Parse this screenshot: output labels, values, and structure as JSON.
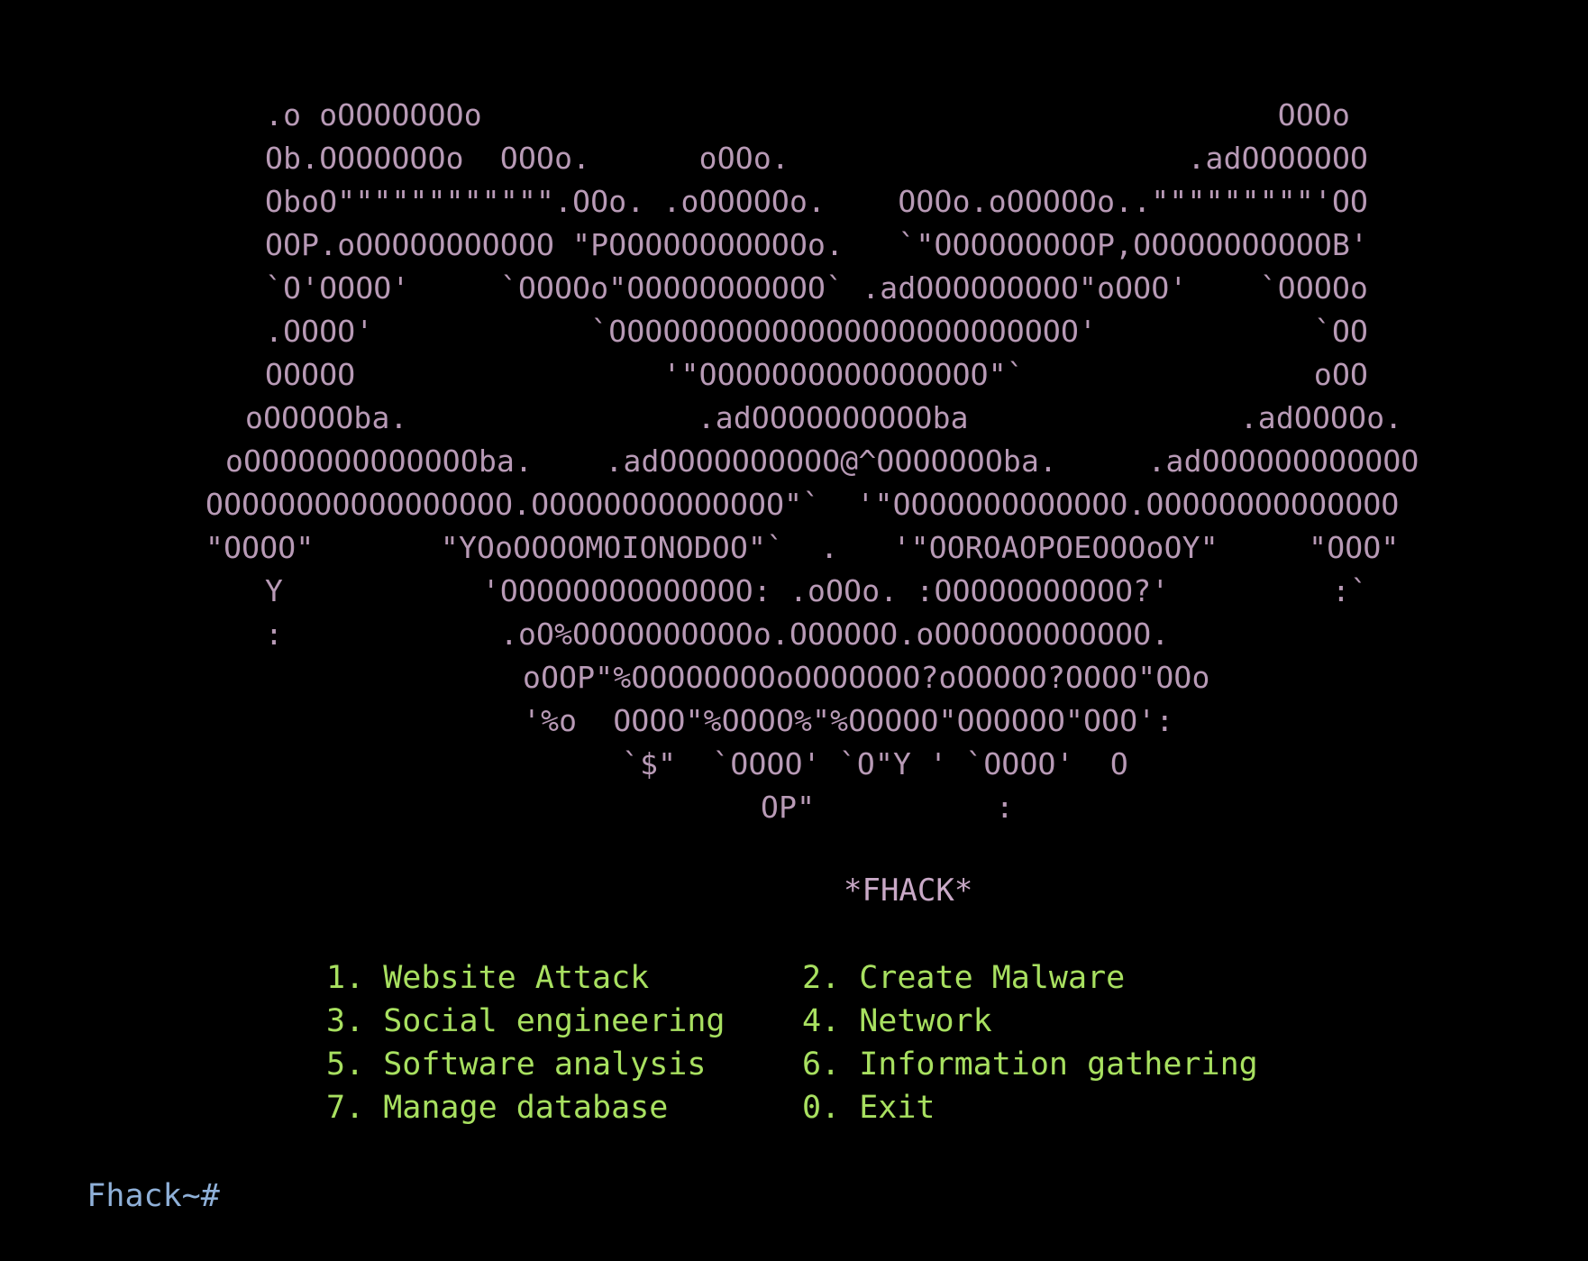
{
  "banner": {
    "lines": [
      ".o oOOOOOOOo                                            OOOo",
      "Ob.OOOOOOOo  OOOo.      oOOo.                      .adOOOOOOO",
      "OboO\"\"\"\"\"\"\"\"\"\"\"\".OOo. .oOOOOOo.    OOOo.oOOOOOo..\"\"\"\"\"\"\"\"\"'OO",
      "OOP.oOOOOOOOOOOO \"POOOOOOOOOOOo.   `\"OOOOOOOOOP,OOOOOOOOOOOB'",
      "`O'OOOO'     `OOOOo\"OOOOOOOOOOO` .adOOOOOOOOO\"oOOO'    `OOOOo",
      ".OOOO'            `OOOOOOOOOOOOOOOOOOOOOOOOOO'            `OO",
      "OOOOO                 '\"OOOOOOOOOOOOOOOO\"`                oOO",
      "oOOOOOba.                .adOOOOOOOOOOba               .adOOOOo.",
      "oOOOOOOOOOOOOOba.    .adOOOOOOOOOO@^OOOOOOOba.     .adOOOOOOOOOOOO",
      "OOOOOOOOOOOOOOOOO.OOOOOOOOOOOOOO\"`  '\"OOOOOOOOOOOOO.OOOOOOOOOOOOOO",
      "\"OOOO\"       \"YOoOOOOMOIONODOO\"`  .   '\"OOROAOPOEOOOoOY\"     \"OOO\"",
      "Y           'OOOOOOOOOOOOOO: .oOOo. :OOOOOOOOOOO?'         :`",
      ":            .oO%OOOOOOOOOOo.OOOOOO.oOOOOOOOOOOOO.",
      "oOOP\"%OOOOOOOOoOOOOOOO?oOOOOO?OOOO\"OOo",
      "'%o  OOOO\"%OOOO%\"%OOOOO\"OOOOOO\"OOO':",
      "`$\"  `OOOO' `O\"Y ' `OOOO'  O",
      "OP\"          :"
    ]
  },
  "title": "*FHACK*",
  "menu": {
    "items": [
      {
        "label": "1. Website Attack"
      },
      {
        "label": "2. Create Malware"
      },
      {
        "label": "3. Social engineering"
      },
      {
        "label": "4. Network"
      },
      {
        "label": "5. Software analysis"
      },
      {
        "label": "6. Information gathering"
      },
      {
        "label": "7. Manage database"
      },
      {
        "label": "0. Exit"
      }
    ]
  },
  "prompt": {
    "text": "Fhack~#"
  },
  "colors": {
    "background": "#000000",
    "banner": "#b89ab6",
    "menu": "#a8e060",
    "prompt": "#8fb0d8"
  }
}
